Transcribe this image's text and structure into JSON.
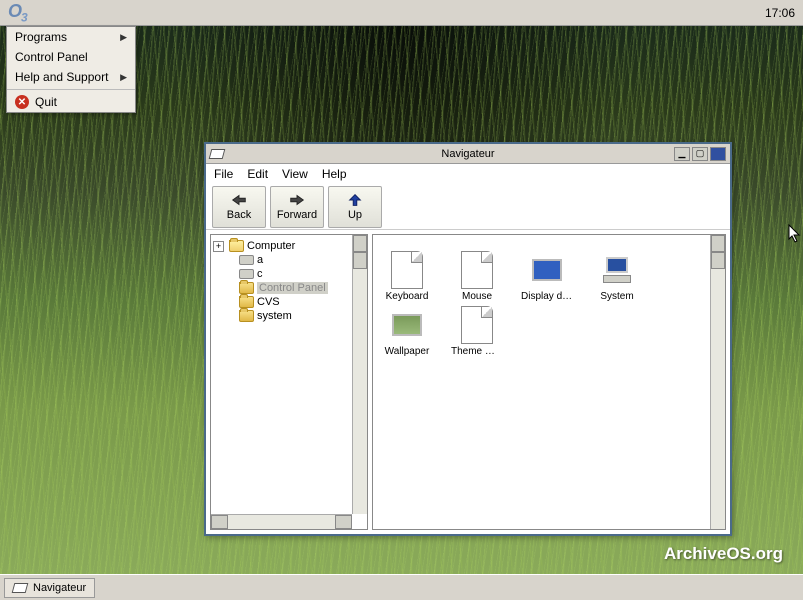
{
  "panel": {
    "logo": "O",
    "logo_sub": "3",
    "clock": "17:06"
  },
  "startMenu": {
    "programs": "Programs",
    "controlPanel": "Control Panel",
    "helpSupport": "Help and Support",
    "quit": "Quit"
  },
  "window": {
    "title": "Navigateur",
    "menu": {
      "file": "File",
      "edit": "Edit",
      "view": "View",
      "help": "Help"
    },
    "toolbar": {
      "back": "Back",
      "forward": "Forward",
      "up": "Up"
    },
    "tree": {
      "root": "Computer",
      "items": [
        {
          "label": "a",
          "type": "drive"
        },
        {
          "label": "c",
          "type": "drive"
        },
        {
          "label": "Control Panel",
          "type": "folder",
          "selected": true
        },
        {
          "label": "CVS",
          "type": "folder"
        },
        {
          "label": "system",
          "type": "folder"
        }
      ]
    },
    "icons": [
      {
        "label": "Keyboard",
        "type": "doc"
      },
      {
        "label": "Mouse",
        "type": "doc"
      },
      {
        "label": "Display device",
        "type": "monitor"
      },
      {
        "label": "System",
        "type": "computer"
      },
      {
        "label": "Wallpaper",
        "type": "wallpaper"
      },
      {
        "label": "Theme man...",
        "type": "doc"
      }
    ]
  },
  "taskbar": {
    "task1": "Navigateur"
  },
  "watermark": "ArchiveOS.org"
}
